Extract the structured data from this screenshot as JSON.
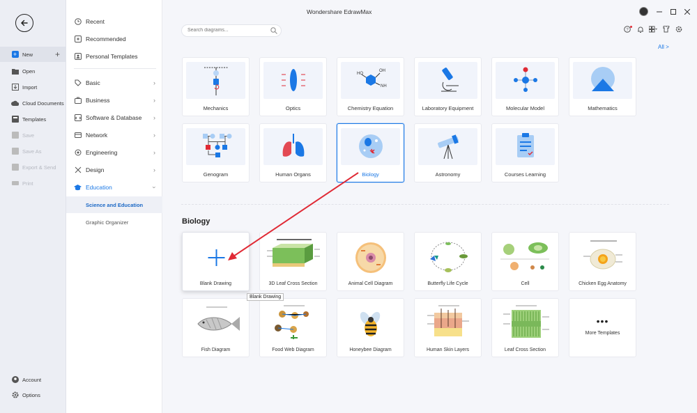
{
  "window": {
    "title": "Wondershare EdrawMax"
  },
  "search": {
    "placeholder": "Search diagrams..."
  },
  "all_link": "All  >",
  "left_rail": {
    "items": [
      {
        "label": "New",
        "icon": "new-icon"
      },
      {
        "label": "Open",
        "icon": "folder-icon"
      },
      {
        "label": "Import",
        "icon": "import-icon"
      },
      {
        "label": "Cloud Documents",
        "icon": "cloud-icon"
      },
      {
        "label": "Templates",
        "icon": "templates-icon"
      },
      {
        "label": "Save",
        "icon": "save-icon"
      },
      {
        "label": "Save As",
        "icon": "save-as-icon"
      },
      {
        "label": "Export & Send",
        "icon": "export-icon"
      },
      {
        "label": "Print",
        "icon": "print-icon"
      }
    ],
    "bottom": [
      {
        "label": "Account",
        "icon": "account-icon"
      },
      {
        "label": "Options",
        "icon": "gear-icon"
      }
    ]
  },
  "categories": {
    "top": [
      {
        "label": "Recent",
        "icon": "clock-icon"
      },
      {
        "label": "Recommended",
        "icon": "recommended-icon"
      },
      {
        "label": "Personal Templates",
        "icon": "person-icon"
      }
    ],
    "main": [
      {
        "label": "Basic",
        "icon": "tag-icon"
      },
      {
        "label": "Business",
        "icon": "briefcase-icon"
      },
      {
        "label": "Software & Database",
        "icon": "software-icon"
      },
      {
        "label": "Network",
        "icon": "network-icon"
      },
      {
        "label": "Engineering",
        "icon": "engineering-icon"
      },
      {
        "label": "Design",
        "icon": "design-icon"
      },
      {
        "label": "Education",
        "icon": "education-icon"
      }
    ],
    "sub": [
      {
        "label": "Science and Education"
      },
      {
        "label": "Graphic Organizer"
      }
    ]
  },
  "diagram_types": [
    {
      "label": "Mechanics"
    },
    {
      "label": "Optics"
    },
    {
      "label": "Chemistry Equation"
    },
    {
      "label": "Laboratory Equipment"
    },
    {
      "label": "Molecular Model"
    },
    {
      "label": "Mathematics"
    },
    {
      "label": "Genogram"
    },
    {
      "label": "Human Organs"
    },
    {
      "label": "Biology"
    },
    {
      "label": "Astronomy"
    },
    {
      "label": "Courses Learning"
    }
  ],
  "section": {
    "title": "Biology"
  },
  "templates": [
    {
      "label": "Blank Drawing"
    },
    {
      "label": "3D Leaf Cross Section"
    },
    {
      "label": "Animal Cell Diagram"
    },
    {
      "label": "Butterfly Life Cycle"
    },
    {
      "label": "Cell"
    },
    {
      "label": "Chicken Egg Anatomy"
    },
    {
      "label": "Fish Diagram"
    },
    {
      "label": "Food Web Diagram"
    },
    {
      "label": "Honeybee Diagram"
    },
    {
      "label": "Human Skin Layers"
    },
    {
      "label": "Leaf Cross Section"
    },
    {
      "label": "More Templates"
    }
  ],
  "tooltip": "Blank Drawing",
  "colors": {
    "accent": "#1b78e5",
    "arrow": "#e02a35"
  }
}
